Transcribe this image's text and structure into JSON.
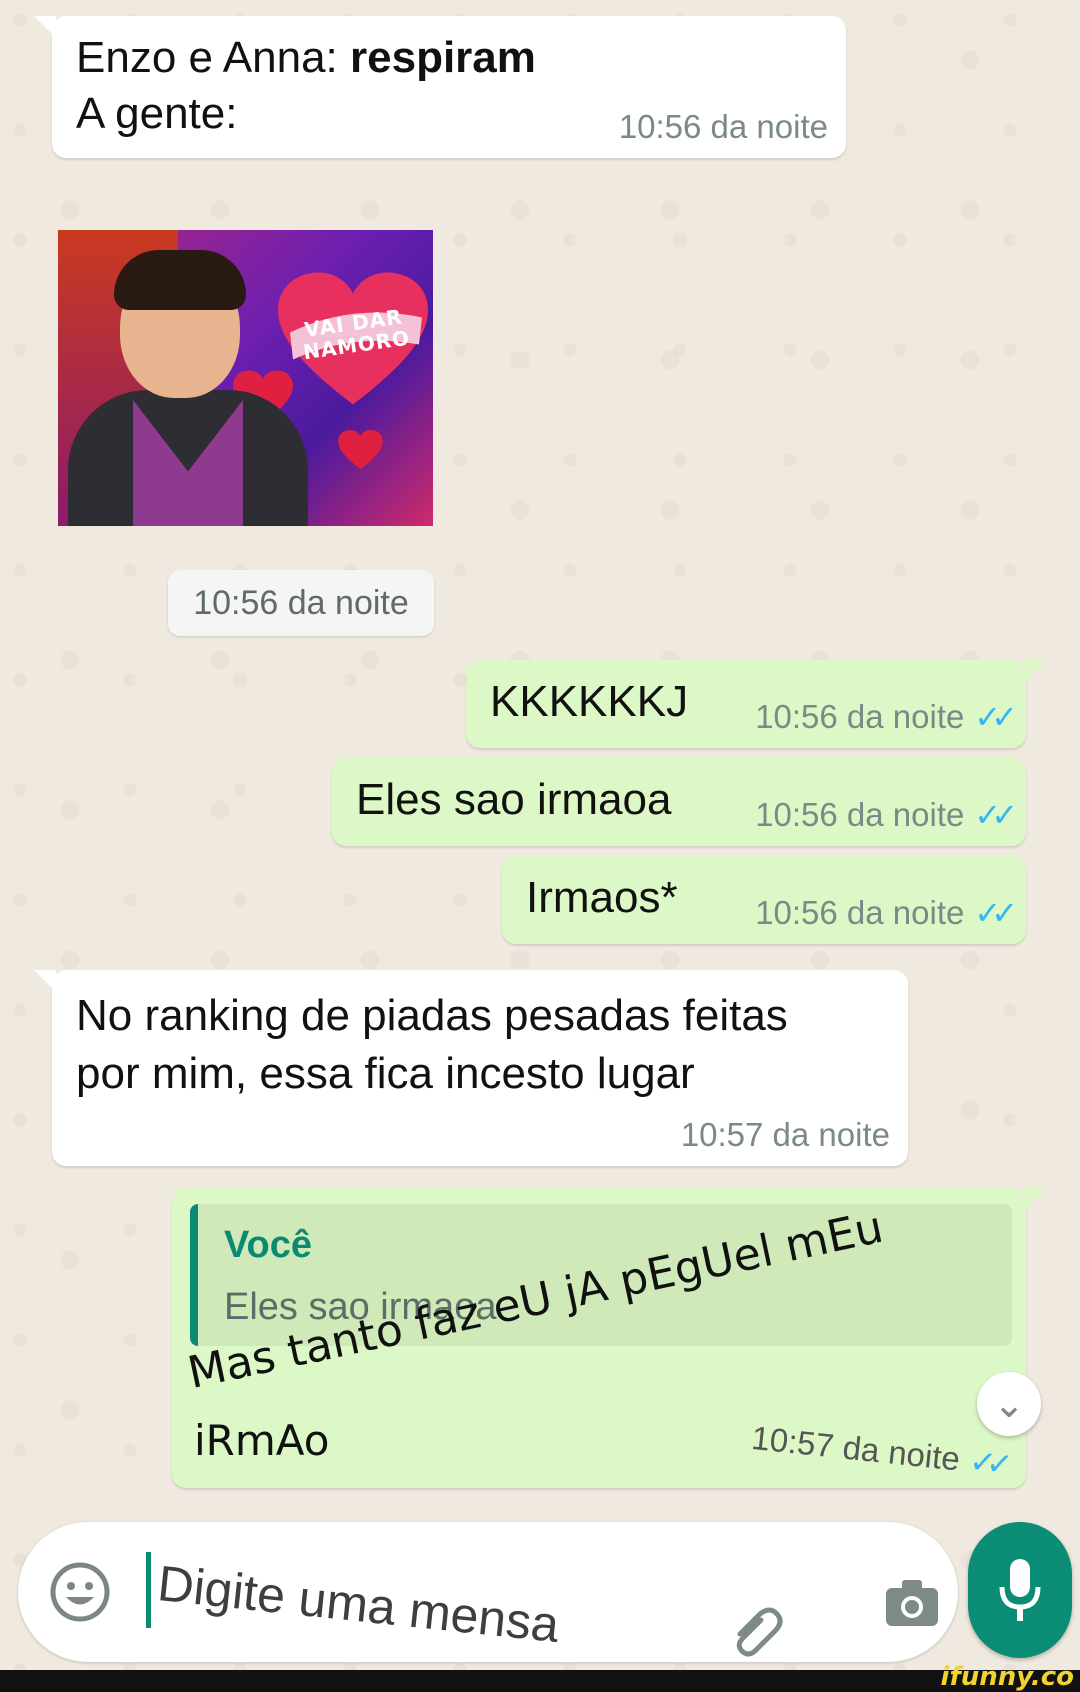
{
  "messages": {
    "m1": {
      "line1_prefix": "Enzo e Anna: ",
      "line1_bold": "respiram",
      "line2": "A gente:",
      "time": "10:56 da noite"
    },
    "photo": {
      "logo_text": "VAI DAR NAMORO"
    },
    "m2_time": "10:56 da noite",
    "m3": {
      "text": "KKKKKKJ",
      "time": "10:56 da noite",
      "ticks": "✓✓"
    },
    "m4": {
      "text": "Eles sao irmaoa",
      "time": "10:56 da noite",
      "ticks": "✓✓"
    },
    "m5": {
      "text": "Irmaos*",
      "time": "10:56 da noite",
      "ticks": "✓✓"
    },
    "m6": {
      "line1": "No ranking de piadas pesadas feitas",
      "line2": "por mim, essa fica incesto lugar",
      "time": "10:57 da noite"
    },
    "m7": {
      "quote_author": "Você",
      "quote_text": "Eles sao irmaoa",
      "body_line1": "Mas tanto faz eU jA pEgUel mEu",
      "body_line2": "iRmAo",
      "time": "10:57 da noite",
      "ticks": "✓✓"
    }
  },
  "input": {
    "placeholder": "Digite uma mensa"
  },
  "icons": {
    "emoji": "smiley-icon",
    "attach": "paperclip-icon",
    "camera": "camera-icon",
    "mic": "microphone-icon",
    "scroll": "chevron-double-down-icon"
  },
  "colors": {
    "incoming": "#ffffff",
    "outgoing": "#dcf8c6",
    "accent": "#0a8d74",
    "read_ticks": "#34b7f1"
  },
  "watermark": "ifunny.co"
}
